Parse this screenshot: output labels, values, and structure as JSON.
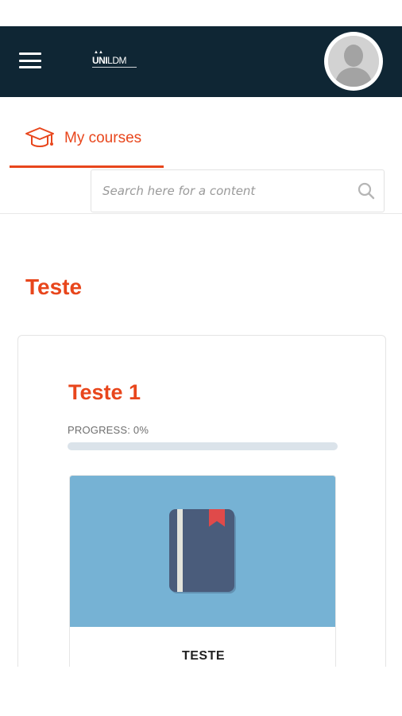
{
  "header": {
    "logo": {
      "text_bold": "UNI",
      "text_light": "LDM"
    },
    "menu_icon": "hamburger-menu-icon",
    "avatar_icon": "user-avatar-icon"
  },
  "tabs": [
    {
      "label": "My courses",
      "icon": "graduation-cap-icon",
      "active": true
    }
  ],
  "search": {
    "placeholder": "Search here for a content",
    "value": "",
    "icon": "search-icon"
  },
  "section": {
    "title": "Teste",
    "course": {
      "title": "Teste 1",
      "progress_label": "PROGRESS: 0%",
      "progress": 0,
      "card_name": "TESTE",
      "card_icon": "book-icon"
    }
  },
  "colors": {
    "header_bg": "#0f2634",
    "accent": "#e8461c",
    "image_bg": "#76b2d4",
    "progress_track": "#dbe3ea"
  }
}
